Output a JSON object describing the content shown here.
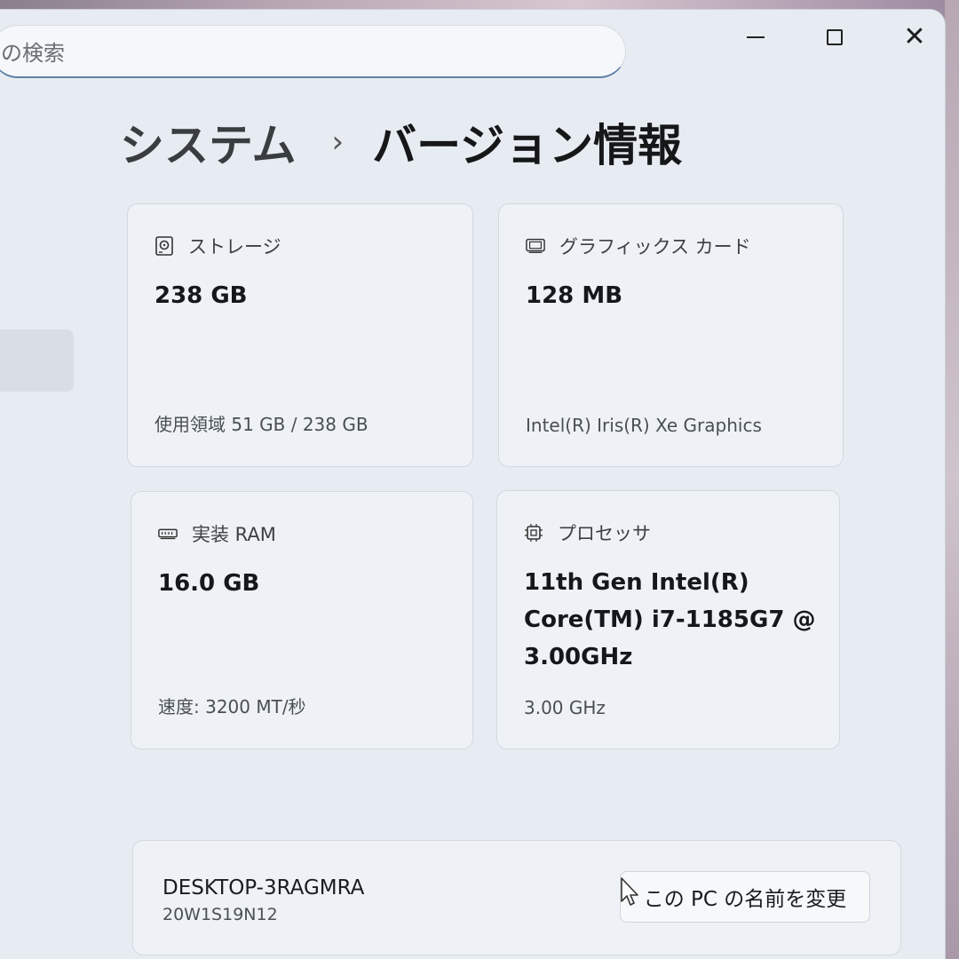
{
  "search": {
    "text": "の検索"
  },
  "window_controls": {
    "minimize": "minimize-icon",
    "maximize": "maximize-icon",
    "close": "close-icon"
  },
  "breadcrumb": {
    "parent": "システム",
    "separator": "›",
    "current": "バージョン情報"
  },
  "cards": {
    "storage": {
      "icon": "hard-drive-icon",
      "title": "ストレージ",
      "value": "238 GB",
      "detail": "使用領域 51 GB / 238 GB"
    },
    "graphics": {
      "icon": "gpu-icon",
      "title": "グラフィックス カード",
      "value": "128 MB",
      "detail": "Intel(R) Iris(R) Xe Graphics"
    },
    "ram": {
      "icon": "memory-icon",
      "title": "実装 RAM",
      "value": "16.0 GB",
      "detail": "速度: 3200 MT/秒"
    },
    "processor": {
      "icon": "processor-icon",
      "title": "プロセッサ",
      "value_lines": [
        "11th Gen Intel(R)",
        "Core(TM) i7-1185G7 @",
        "3.00GHz"
      ],
      "detail": "3.00 GHz"
    }
  },
  "device": {
    "name": "DESKTOP-3RAGMRA",
    "model": "20W1S19N12",
    "rename_label": "この PC の名前を変更"
  }
}
